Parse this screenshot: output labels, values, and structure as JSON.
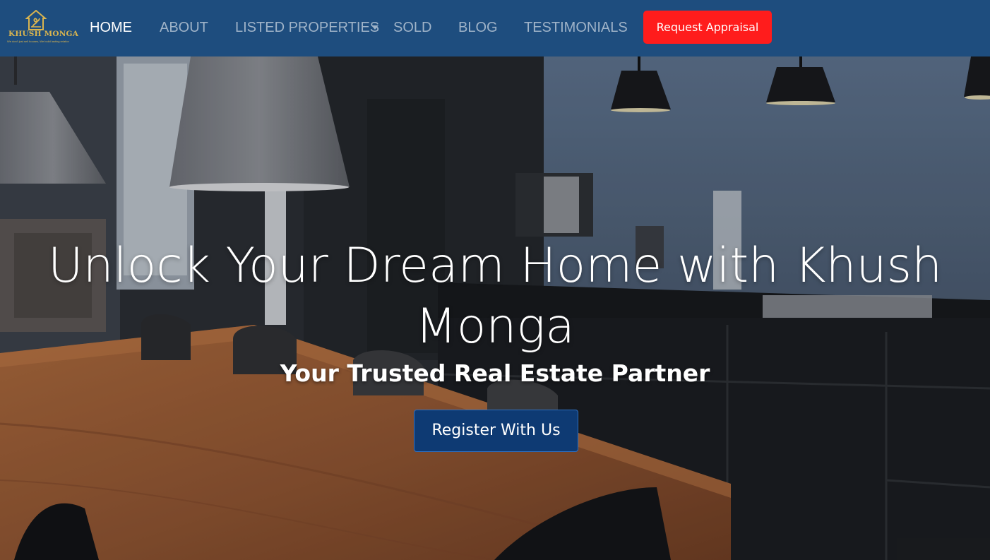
{
  "brand": {
    "name": "KHUSH MONGA",
    "tagline": "We don't just sell houses, We build lasting relationships",
    "accent_color": "#d9b44f"
  },
  "nav": {
    "background_color": "#1e4d7e",
    "items": [
      {
        "label": "HOME",
        "active": true
      },
      {
        "label": "ABOUT"
      },
      {
        "label": "LISTED PROPERTIES",
        "has_dropdown": true
      },
      {
        "label": "SOLD"
      },
      {
        "label": "BLOG"
      },
      {
        "label": "TESTIMONIALS"
      }
    ],
    "cta_label": "Request Appraisal",
    "cta_color": "#ff1c1c"
  },
  "hero": {
    "background": "modern kitchen interior with wooden dining table and black pendant lamps",
    "title": "Unlock Your Dream Home with Khush Monga",
    "subtitle": "Your Trusted Real Estate Partner",
    "button_label": "Register With Us",
    "button_color": "#0e3a73"
  }
}
